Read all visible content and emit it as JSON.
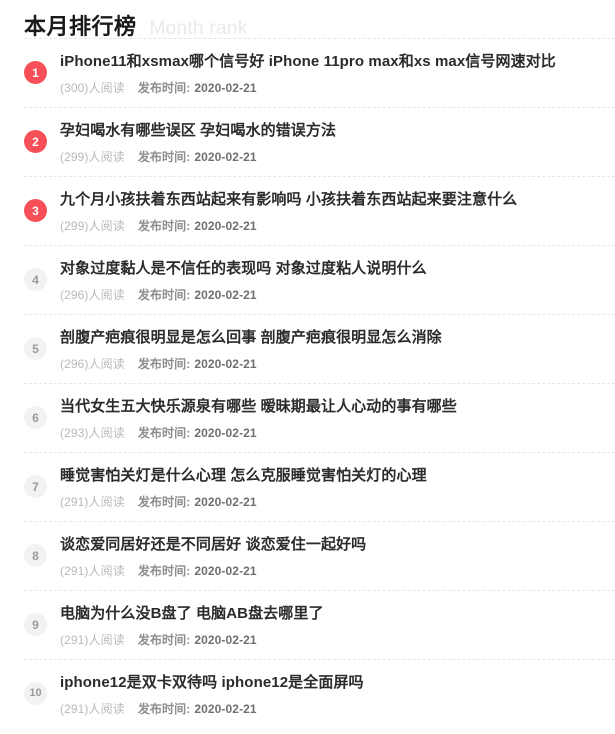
{
  "header": {
    "title_cn": "本月排行榜",
    "title_en": "Month rank"
  },
  "meta_labels": {
    "reads_suffix": "人阅读",
    "date_label": "发布时间:"
  },
  "colors": {
    "hot_badge": "#f74f57",
    "normal_badge_bg": "#f2f2f2",
    "normal_badge_text": "#9b9b9b",
    "title_text": "#2b2b2b",
    "header_en_text": "#e9e9e9",
    "divider": "#e6e6e6"
  },
  "items": [
    {
      "rank": "1",
      "hot": true,
      "title": "iPhone11和xsmax哪个信号好 iPhone 11pro max和xs max信号网速对比",
      "reads": "(300)人阅读",
      "date_label": "发布时间:",
      "date": "2020-02-21"
    },
    {
      "rank": "2",
      "hot": true,
      "title": "孕妇喝水有哪些误区 孕妇喝水的错误方法",
      "reads": "(299)人阅读",
      "date_label": "发布时间:",
      "date": "2020-02-21"
    },
    {
      "rank": "3",
      "hot": true,
      "title": "九个月小孩扶着东西站起来有影响吗 小孩扶着东西站起来要注意什么",
      "reads": "(299)人阅读",
      "date_label": "发布时间:",
      "date": "2020-02-21"
    },
    {
      "rank": "4",
      "hot": false,
      "title": "对象过度黏人是不信任的表现吗 对象过度粘人说明什么",
      "reads": "(296)人阅读",
      "date_label": "发布时间:",
      "date": "2020-02-21"
    },
    {
      "rank": "5",
      "hot": false,
      "title": "剖腹产疤痕很明显是怎么回事 剖腹产疤痕很明显怎么消除",
      "reads": "(296)人阅读",
      "date_label": "发布时间:",
      "date": "2020-02-21"
    },
    {
      "rank": "6",
      "hot": false,
      "title": "当代女生五大快乐源泉有哪些 暧昧期最让人心动的事有哪些",
      "reads": "(293)人阅读",
      "date_label": "发布时间:",
      "date": "2020-02-21"
    },
    {
      "rank": "7",
      "hot": false,
      "title": "睡觉害怕关灯是什么心理 怎么克服睡觉害怕关灯的心理",
      "reads": "(291)人阅读",
      "date_label": "发布时间:",
      "date": "2020-02-21"
    },
    {
      "rank": "8",
      "hot": false,
      "title": "谈恋爱同居好还是不同居好 谈恋爱住一起好吗",
      "reads": "(291)人阅读",
      "date_label": "发布时间:",
      "date": "2020-02-21"
    },
    {
      "rank": "9",
      "hot": false,
      "title": "电脑为什么没B盘了 电脑AB盘去哪里了",
      "reads": "(291)人阅读",
      "date_label": "发布时间:",
      "date": "2020-02-21"
    },
    {
      "rank": "10",
      "hot": false,
      "title": "iphone12是双卡双待吗 iphone12是全面屏吗",
      "reads": "(291)人阅读",
      "date_label": "发布时间:",
      "date": "2020-02-21"
    }
  ]
}
